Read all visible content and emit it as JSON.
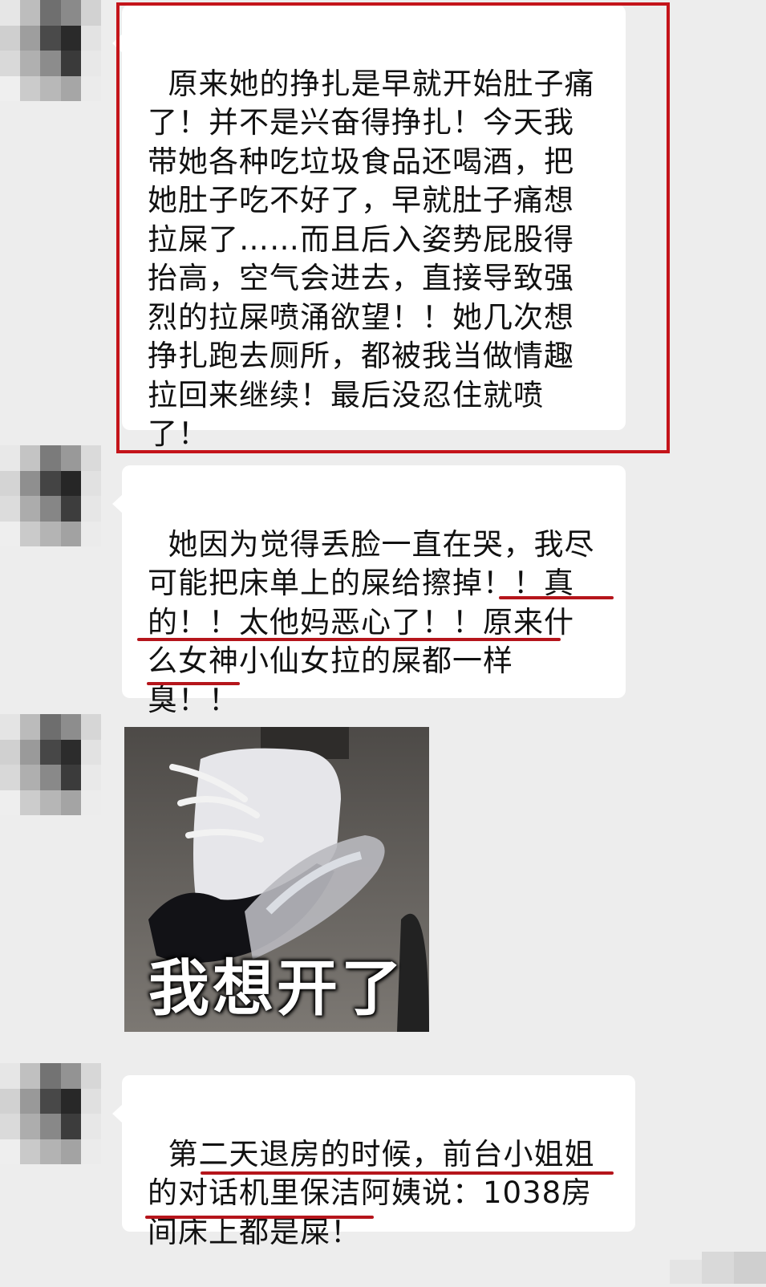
{
  "messages": [
    {
      "sender": "contact",
      "type": "text",
      "text": "原来她的挣扎是早就开始肚子痛了！并不是兴奋得挣扎！今天我带她各种吃垃圾食品还喝酒，把她肚子吃不好了，早就肚子痛想拉屎了……而且后入姿势屁股得抬高，空气会进去，直接导致强烈的拉屎喷涌欲望！！她几次想挣扎跑去厕所，都被我当做情趣拉回来继续！最后没忍住就喷了！",
      "highlighted": true
    },
    {
      "sender": "contact",
      "type": "text",
      "text": "她因为觉得丢脸一直在哭，我尽可能把床单上的屎给擦掉！！真的！！太他妈恶心了！！原来什么女神小仙女拉的屎都一样臭！！"
    },
    {
      "sender": "contact",
      "type": "image",
      "caption": "我想开了"
    },
    {
      "sender": "contact",
      "type": "text",
      "text": "第二天退房的时候，前台小姐姐的对话机里保洁阿姨说：1038房间床上都是屎！"
    }
  ],
  "colors": {
    "background": "#ededed",
    "bubble": "#ffffff",
    "highlight_border": "#c4141a",
    "underline": "#b5151b"
  }
}
